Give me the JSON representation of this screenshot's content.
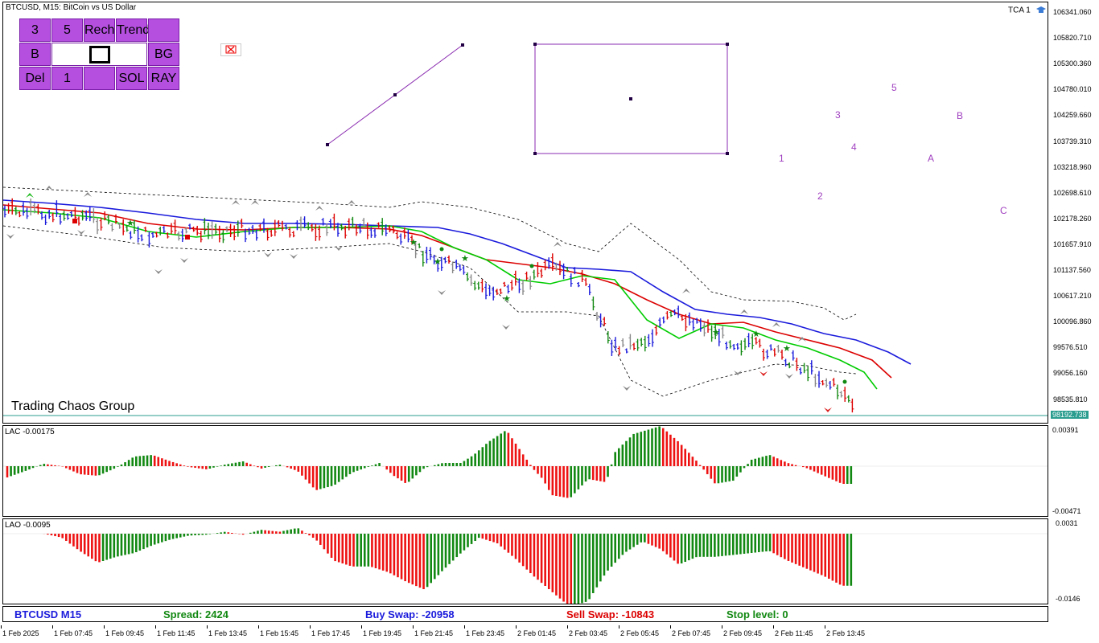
{
  "symbol_title": "BTCUSD, M15:  BitCoin vs US Dollar",
  "watermark": "Trading Chaos Group",
  "tca_label": "TCA 1",
  "buttons": {
    "row1": [
      "3",
      "5",
      "Rech",
      "Trend",
      ""
    ],
    "row2": [
      "B",
      "",
      "",
      "",
      "BG"
    ],
    "row3": [
      "Del",
      "1",
      "",
      "SOL",
      "RAY"
    ]
  },
  "wave_labels": [
    "1",
    "2",
    "3",
    "4",
    "5",
    "A",
    "B",
    "C"
  ],
  "price_scale": [
    "106341.060",
    "105820.710",
    "105300.360",
    "104780.010",
    "104259.660",
    "103739.310",
    "103218.960",
    "102698.610",
    "102178.260",
    "101657.910",
    "101137.560",
    "100617.210",
    "100096.860",
    "99576.510",
    "99056.160",
    "98535.810"
  ],
  "current_price": "98192.738",
  "lac": {
    "title": "LAC -0.00175",
    "scale": [
      "0.00391",
      "-0.00471"
    ]
  },
  "lao": {
    "title": "LAO -0.0095",
    "scale": [
      "0.0031",
      "-0.0146"
    ]
  },
  "info_bar": {
    "symbol": "BTCUSD M15",
    "spread": "Spread: 2424",
    "buy_swap": "Buy Swap: -20958",
    "sell_swap": "Sell Swap: -10843",
    "stop_level": "Stop level: 0"
  },
  "time_axis": [
    "1 Feb 2025",
    "1 Feb 07:45",
    "1 Feb 09:45",
    "1 Feb 11:45",
    "1 Feb 13:45",
    "1 Feb 15:45",
    "1 Feb 17:45",
    "1 Feb 19:45",
    "1 Feb 21:45",
    "1 Feb 23:45",
    "2 Feb 01:45",
    "2 Feb 03:45",
    "2 Feb 05:45",
    "2 Feb 07:45",
    "2 Feb 09:45",
    "2 Feb 11:45",
    "2 Feb 13:45"
  ],
  "colors": {
    "blue_line": "#1a1adc",
    "red_line": "#dc0000",
    "green_line": "#00cc00",
    "bull_bar": "#1a1adc",
    "bear_bar": "#dc0000",
    "osc_up": "#118811",
    "osc_down": "#ee1111",
    "button_purple": "#b44fe0",
    "wave_purple": "#a040c0",
    "price_line": "#2a9d8f"
  }
}
